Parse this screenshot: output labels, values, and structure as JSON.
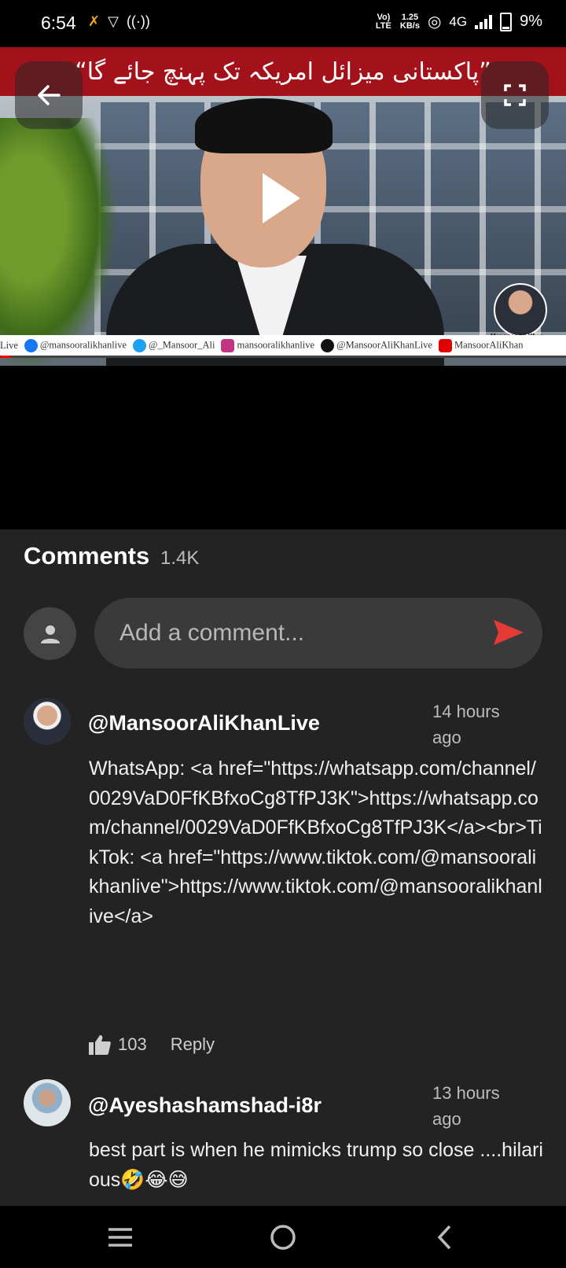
{
  "status_bar": {
    "time": "6:54",
    "volte": "Vo) LTE",
    "speed_value": "1.25",
    "speed_unit": "KB/s",
    "network": "4G",
    "battery": "9%"
  },
  "video": {
    "banner_text": "”پاکستانی میزائل امریکہ تک پہنچ جائے گا“",
    "watermark_name": "Mansoor Ali Khan",
    "ticker": [
      {
        "icon": "facebook-icon",
        "text": "@mansooralikhanlive",
        "color": "#1877f2"
      },
      {
        "icon": "twitter-icon",
        "text": "@_Mansoor_Ali",
        "color": "#1da1f2"
      },
      {
        "icon": "instagram-icon",
        "text": "mansooralikhanlive",
        "color": "#c13584"
      },
      {
        "icon": "tiktok-icon",
        "text": "@MansoorAliKhanLive",
        "color": "#111111"
      },
      {
        "icon": "youtube-icon",
        "text": "MansoorAliKhan",
        "color": "#e00000"
      }
    ],
    "ticker_prefix": "Live",
    "progress": 0.02
  },
  "comments": {
    "title": "Comments",
    "count": "1.4K",
    "input_placeholder": "Add a comment...",
    "items": [
      {
        "author": "@MansoorAliKhanLive",
        "time": "14 hours ago",
        "text": "WhatsApp: <a href=\"https://whatsapp.com/channel/0029VaD0FfKBfxoCg8TfPJ3K\">https://whatsapp.com/channel/0029VaD0FfKBfxoCg8TfPJ3K</a><br>TikTok: <a href=\"https://www.tiktok.com/@mansooralikhanlive\">https://www.tiktok.com/@mansooralikhanlive</a>",
        "likes": "103",
        "reply_label": "Reply"
      },
      {
        "author": "@Ayeshashamshad-i8r",
        "time": "13 hours ago",
        "text": "best part is when he mimicks trump so close ....hilarious🤣😂😅"
      }
    ]
  },
  "colors": {
    "accent_send": "#e53935",
    "banner": "#a3111a",
    "background": "#232323"
  }
}
